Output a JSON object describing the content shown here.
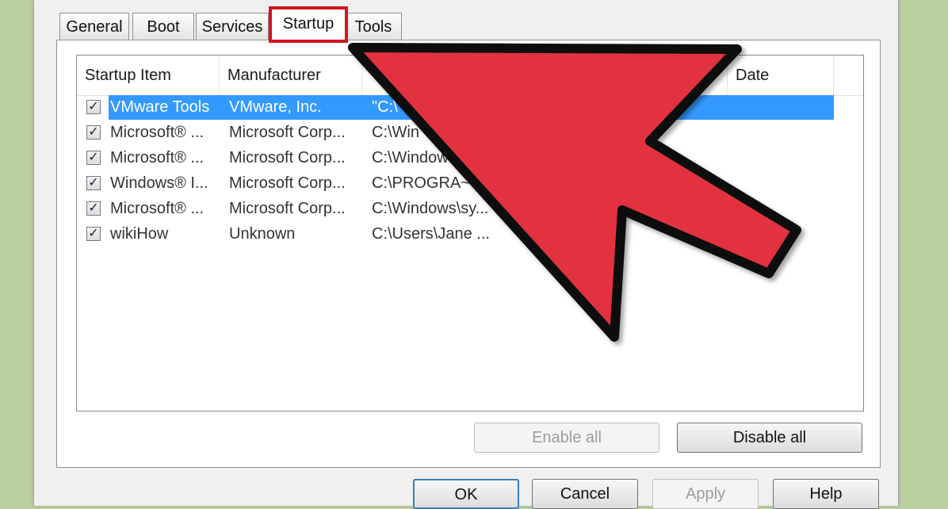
{
  "tabs": [
    "General",
    "Boot",
    "Services",
    "Startup",
    "Tools"
  ],
  "columns": {
    "item": "Startup Item",
    "manufacturer": "Manufacturer",
    "disabled": "Date Disabled"
  },
  "rows": [
    {
      "item": "VMware Tools",
      "manufacturer": "VMware, Inc.",
      "command": "\"C:\\",
      "checked": "✓"
    },
    {
      "item": "Microsoft® ...",
      "manufacturer": "Microsoft Corp...",
      "command": "C:\\Win",
      "checked": "✓"
    },
    {
      "item": "Microsoft® ...",
      "manufacturer": "Microsoft Corp...",
      "command": "C:\\Window",
      "checked": "✓"
    },
    {
      "item": "Windows® I...",
      "manufacturer": "Microsoft Corp...",
      "command": "C:\\PROGRA~",
      "checked": "✓"
    },
    {
      "item": "Microsoft® ...",
      "manufacturer": "Microsoft Corp...",
      "command": "C:\\Windows\\sy...",
      "checked": "✓"
    },
    {
      "item": "wikiHow",
      "manufacturer": "Unknown",
      "command": "C:\\Users\\Jane ...",
      "checked": "✓"
    }
  ],
  "buttons": {
    "enable_all": "Enable all",
    "disable_all": "Disable all",
    "ok": "OK",
    "cancel": "Cancel",
    "apply": "Apply",
    "help": "Help"
  },
  "colors": {
    "background": "#b9cf9d",
    "selection": "#3399ff",
    "highlight_box": "#d1151e",
    "arrow_fill": "#e23340"
  }
}
